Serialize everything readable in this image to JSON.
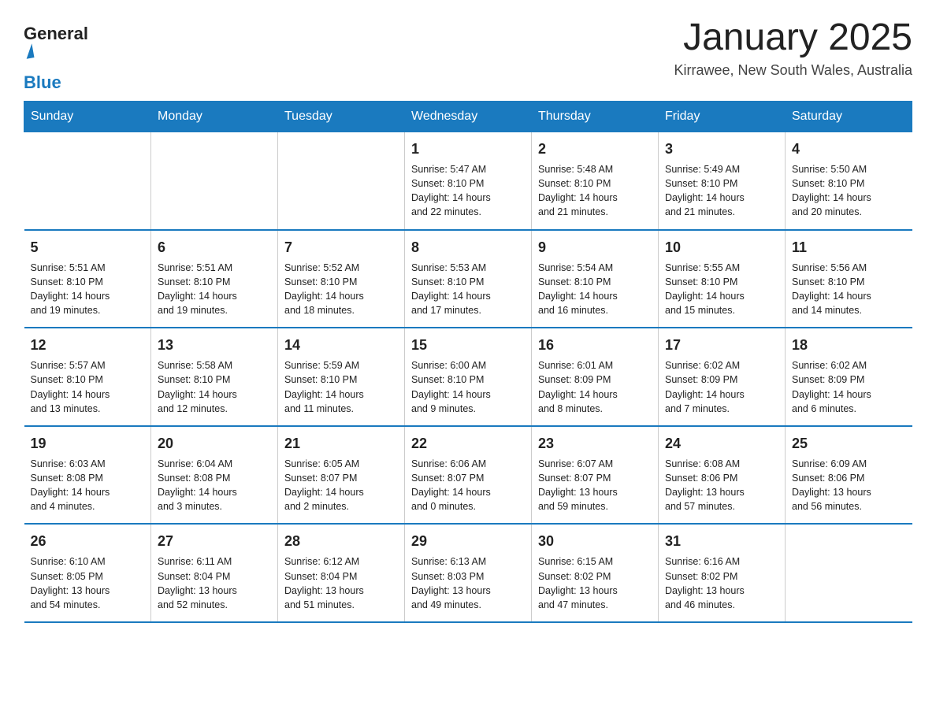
{
  "logo": {
    "text_general": "General",
    "text_blue": "Blue",
    "alt": "GeneralBlue logo"
  },
  "title": "January 2025",
  "subtitle": "Kirrawee, New South Wales, Australia",
  "days_of_week": [
    "Sunday",
    "Monday",
    "Tuesday",
    "Wednesday",
    "Thursday",
    "Friday",
    "Saturday"
  ],
  "weeks": [
    [
      {
        "day": "",
        "info": ""
      },
      {
        "day": "",
        "info": ""
      },
      {
        "day": "",
        "info": ""
      },
      {
        "day": "1",
        "info": "Sunrise: 5:47 AM\nSunset: 8:10 PM\nDaylight: 14 hours\nand 22 minutes."
      },
      {
        "day": "2",
        "info": "Sunrise: 5:48 AM\nSunset: 8:10 PM\nDaylight: 14 hours\nand 21 minutes."
      },
      {
        "day": "3",
        "info": "Sunrise: 5:49 AM\nSunset: 8:10 PM\nDaylight: 14 hours\nand 21 minutes."
      },
      {
        "day": "4",
        "info": "Sunrise: 5:50 AM\nSunset: 8:10 PM\nDaylight: 14 hours\nand 20 minutes."
      }
    ],
    [
      {
        "day": "5",
        "info": "Sunrise: 5:51 AM\nSunset: 8:10 PM\nDaylight: 14 hours\nand 19 minutes."
      },
      {
        "day": "6",
        "info": "Sunrise: 5:51 AM\nSunset: 8:10 PM\nDaylight: 14 hours\nand 19 minutes."
      },
      {
        "day": "7",
        "info": "Sunrise: 5:52 AM\nSunset: 8:10 PM\nDaylight: 14 hours\nand 18 minutes."
      },
      {
        "day": "8",
        "info": "Sunrise: 5:53 AM\nSunset: 8:10 PM\nDaylight: 14 hours\nand 17 minutes."
      },
      {
        "day": "9",
        "info": "Sunrise: 5:54 AM\nSunset: 8:10 PM\nDaylight: 14 hours\nand 16 minutes."
      },
      {
        "day": "10",
        "info": "Sunrise: 5:55 AM\nSunset: 8:10 PM\nDaylight: 14 hours\nand 15 minutes."
      },
      {
        "day": "11",
        "info": "Sunrise: 5:56 AM\nSunset: 8:10 PM\nDaylight: 14 hours\nand 14 minutes."
      }
    ],
    [
      {
        "day": "12",
        "info": "Sunrise: 5:57 AM\nSunset: 8:10 PM\nDaylight: 14 hours\nand 13 minutes."
      },
      {
        "day": "13",
        "info": "Sunrise: 5:58 AM\nSunset: 8:10 PM\nDaylight: 14 hours\nand 12 minutes."
      },
      {
        "day": "14",
        "info": "Sunrise: 5:59 AM\nSunset: 8:10 PM\nDaylight: 14 hours\nand 11 minutes."
      },
      {
        "day": "15",
        "info": "Sunrise: 6:00 AM\nSunset: 8:10 PM\nDaylight: 14 hours\nand 9 minutes."
      },
      {
        "day": "16",
        "info": "Sunrise: 6:01 AM\nSunset: 8:09 PM\nDaylight: 14 hours\nand 8 minutes."
      },
      {
        "day": "17",
        "info": "Sunrise: 6:02 AM\nSunset: 8:09 PM\nDaylight: 14 hours\nand 7 minutes."
      },
      {
        "day": "18",
        "info": "Sunrise: 6:02 AM\nSunset: 8:09 PM\nDaylight: 14 hours\nand 6 minutes."
      }
    ],
    [
      {
        "day": "19",
        "info": "Sunrise: 6:03 AM\nSunset: 8:08 PM\nDaylight: 14 hours\nand 4 minutes."
      },
      {
        "day": "20",
        "info": "Sunrise: 6:04 AM\nSunset: 8:08 PM\nDaylight: 14 hours\nand 3 minutes."
      },
      {
        "day": "21",
        "info": "Sunrise: 6:05 AM\nSunset: 8:07 PM\nDaylight: 14 hours\nand 2 minutes."
      },
      {
        "day": "22",
        "info": "Sunrise: 6:06 AM\nSunset: 8:07 PM\nDaylight: 14 hours\nand 0 minutes."
      },
      {
        "day": "23",
        "info": "Sunrise: 6:07 AM\nSunset: 8:07 PM\nDaylight: 13 hours\nand 59 minutes."
      },
      {
        "day": "24",
        "info": "Sunrise: 6:08 AM\nSunset: 8:06 PM\nDaylight: 13 hours\nand 57 minutes."
      },
      {
        "day": "25",
        "info": "Sunrise: 6:09 AM\nSunset: 8:06 PM\nDaylight: 13 hours\nand 56 minutes."
      }
    ],
    [
      {
        "day": "26",
        "info": "Sunrise: 6:10 AM\nSunset: 8:05 PM\nDaylight: 13 hours\nand 54 minutes."
      },
      {
        "day": "27",
        "info": "Sunrise: 6:11 AM\nSunset: 8:04 PM\nDaylight: 13 hours\nand 52 minutes."
      },
      {
        "day": "28",
        "info": "Sunrise: 6:12 AM\nSunset: 8:04 PM\nDaylight: 13 hours\nand 51 minutes."
      },
      {
        "day": "29",
        "info": "Sunrise: 6:13 AM\nSunset: 8:03 PM\nDaylight: 13 hours\nand 49 minutes."
      },
      {
        "day": "30",
        "info": "Sunrise: 6:15 AM\nSunset: 8:02 PM\nDaylight: 13 hours\nand 47 minutes."
      },
      {
        "day": "31",
        "info": "Sunrise: 6:16 AM\nSunset: 8:02 PM\nDaylight: 13 hours\nand 46 minutes."
      },
      {
        "day": "",
        "info": ""
      }
    ]
  ]
}
